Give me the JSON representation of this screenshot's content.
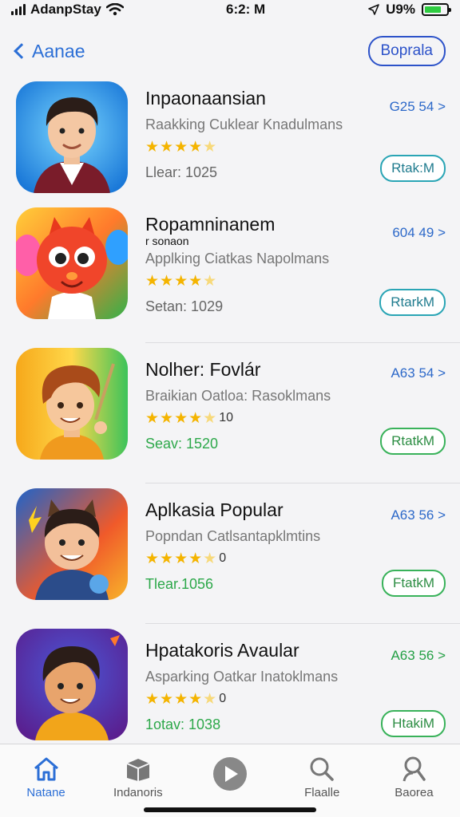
{
  "status": {
    "carrier": "AdanpStay",
    "time": "6:2: M",
    "battery": "U9%",
    "battery_level": 0.75
  },
  "nav": {
    "back_label": "Aanae",
    "top_button": "Boprala"
  },
  "apps": [
    {
      "title": "Inpaonaansian",
      "subtitle": "",
      "category": "Raakking Cuklear Knadulmans",
      "rating": "",
      "stars": 4,
      "meta": "Llear: 1025",
      "meta_green": false,
      "code": "G25 54 >",
      "code_green": false,
      "action": "Rtak:M",
      "action_green": false
    },
    {
      "title": "Ropamninanem",
      "subtitle": "r sonaon",
      "category": "Applking Ciatkas Napolmans",
      "rating": "",
      "stars": 4,
      "meta": "Setan: 1029",
      "meta_green": false,
      "code": "604 49 >",
      "code_green": false,
      "action": "RtarkM",
      "action_green": false
    },
    {
      "title": "Nolher: Fovlár",
      "subtitle": "",
      "category": "Braikian Oatloa: Rasoklmans",
      "rating": "10",
      "stars": 4,
      "meta": "Seav: 1520",
      "meta_green": true,
      "code": "A63 54 >",
      "code_green": false,
      "action": "RtatkM",
      "action_green": true
    },
    {
      "title": "Aplkasia Popular",
      "subtitle": "",
      "category": "Popndan Catlsantapklmtins",
      "rating": "0",
      "stars": 4,
      "meta": "Tlear.1056",
      "meta_green": true,
      "code": "A63 56 >",
      "code_green": false,
      "action": "FtatkM",
      "action_green": true
    },
    {
      "title": "Hpatakoris Avaular",
      "subtitle": "",
      "category": "Asparking Oatkar Inatoklmans",
      "rating": "0",
      "stars": 4,
      "meta": "1otav: 1038",
      "meta_green": true,
      "code": "A63 56 >",
      "code_green": true,
      "action": "HtakiM",
      "action_green": true
    }
  ],
  "tabs": [
    {
      "label": "Natane",
      "icon": "home-icon",
      "active": true
    },
    {
      "label": "Indanoris",
      "icon": "box-icon",
      "active": false
    },
    {
      "label": "",
      "icon": "play-icon",
      "active": false
    },
    {
      "label": "Flaalle",
      "icon": "search-icon",
      "active": false
    },
    {
      "label": "Baorea",
      "icon": "person-search-icon",
      "active": false
    }
  ]
}
